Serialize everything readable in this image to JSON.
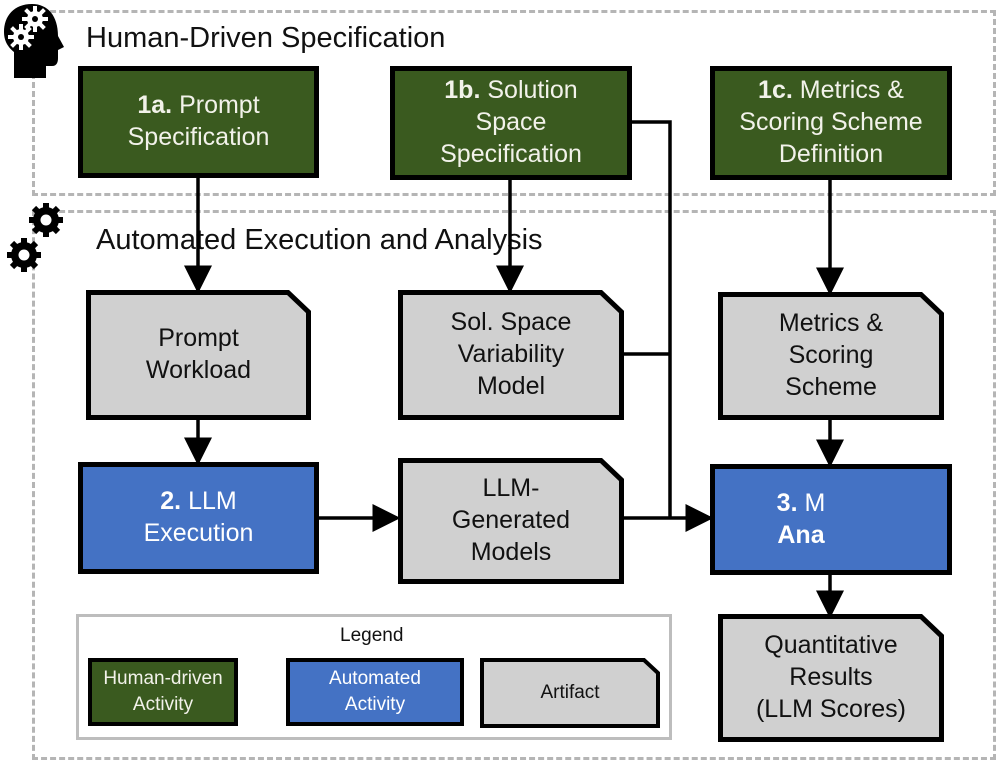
{
  "regions": {
    "human": {
      "title": "Human-Driven Specification",
      "icon": "head-gears-icon"
    },
    "automated": {
      "title": "Automated Execution and Analysis",
      "icon": "gears-icon"
    }
  },
  "nodes": {
    "n1a": {
      "type": "human-activity",
      "num": "1a.",
      "lines": [
        "Prompt",
        "Specification"
      ]
    },
    "n1b": {
      "type": "human-activity",
      "num": "1b.",
      "lines": [
        "Solution",
        "Space",
        "Specification"
      ]
    },
    "n1c": {
      "type": "human-activity",
      "num": "1c.",
      "lines": [
        "Metrics &",
        "Scoring Scheme",
        "Definition"
      ]
    },
    "prompt_workload": {
      "type": "artifact",
      "lines": [
        "Prompt",
        "Workload"
      ]
    },
    "sol_space_model": {
      "type": "artifact",
      "lines": [
        "Sol. Space",
        "Variability",
        "Model"
      ]
    },
    "metrics_scheme": {
      "type": "artifact",
      "lines": [
        "Metrics &",
        "Scoring",
        "Scheme"
      ]
    },
    "n2": {
      "type": "automated-activity",
      "num": "2.",
      "lines": [
        "LLM",
        "Execution"
      ]
    },
    "llm_models": {
      "type": "artifact",
      "lines": [
        "LLM-",
        "Generated",
        "Models"
      ]
    },
    "n3": {
      "type": "automated-activity",
      "num": "3.",
      "lines": [
        "M",
        "Ana"
      ]
    },
    "results": {
      "type": "artifact",
      "lines": [
        "Quantitative",
        "Results",
        "(LLM Scores)"
      ]
    }
  },
  "edges": [
    {
      "from": "n1a",
      "to": "prompt_workload"
    },
    {
      "from": "n1b",
      "to": "sol_space_model"
    },
    {
      "from": "n1b",
      "to": "n3"
    },
    {
      "from": "sol_space_model",
      "to": "n3"
    },
    {
      "from": "n1c",
      "to": "metrics_scheme"
    },
    {
      "from": "prompt_workload",
      "to": "n2"
    },
    {
      "from": "n2",
      "to": "llm_models"
    },
    {
      "from": "llm_models",
      "to": "n3"
    },
    {
      "from": "metrics_scheme",
      "to": "n3"
    },
    {
      "from": "n3",
      "to": "results"
    }
  ],
  "legend": {
    "title": "Legend",
    "items": [
      {
        "type": "human-activity",
        "lines": [
          "Human-driven",
          "Activity"
        ]
      },
      {
        "type": "automated-activity",
        "lines": [
          "Automated",
          "Activity"
        ]
      },
      {
        "type": "artifact",
        "lines": [
          "Artifact"
        ]
      }
    ]
  },
  "colors": {
    "human_activity": "#3a5a1f",
    "automated_activity": "#4472c4",
    "artifact": "#d0d0d0",
    "region_border": "#b5b5b5"
  }
}
